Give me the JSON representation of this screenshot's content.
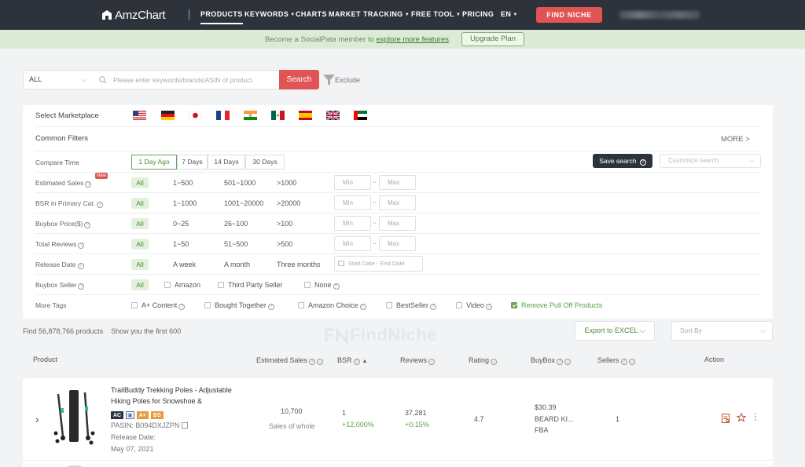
{
  "brand": {
    "name": "AmzChart"
  },
  "nav": {
    "items": [
      {
        "label": "PRODUCTS",
        "active": true
      },
      {
        "label": "KEYWORDS"
      },
      {
        "label": "CHARTS"
      },
      {
        "label": "MARKET"
      },
      {
        "label": "TRACKING"
      },
      {
        "label": "FREE TOOL"
      },
      {
        "label": "PRICING"
      },
      {
        "label": "EN"
      }
    ],
    "find_niche_label": "FIND NICHE"
  },
  "banner": {
    "prefix": "Become a SocialPata member to ",
    "link": "explore more features",
    "suffix": ".",
    "upgrade_label": "Upgrade Plan"
  },
  "search": {
    "category_value": "ALL",
    "placeholder": "Please enter keywords/brands/ASIN of product",
    "button_label": "Search",
    "exclude_label": "Exclude"
  },
  "filters": {
    "marketplace_label": "Select Marketplace",
    "marketplaces": [
      "us-flag-icon",
      "de-flag-icon",
      "jp-flag-icon",
      "fr-flag-icon",
      "in-flag-icon",
      "mx-flag-icon",
      "es-flag-icon",
      "uk-flag-icon",
      "ae-flag-icon"
    ],
    "common_filters_label": "Common Filters",
    "more_label": "MORE >",
    "compare_time": {
      "label": "Compare Time",
      "options": [
        "1 Day Ago",
        "7 Days",
        "14 Days",
        "30 Days"
      ],
      "selected": "1 Day Ago"
    },
    "save_search_label": "Save search",
    "customize_search_placeholder": "Customize search",
    "new_badge": "New",
    "all_label": "All",
    "min_placeholder": "Min",
    "max_placeholder": "Max",
    "range_sep": "~",
    "estimated_sales": {
      "label": "Estimated Sales",
      "options": [
        "1~500",
        "501~1000",
        ">1000"
      ]
    },
    "bsr": {
      "label": "BSR in Primary Cat.",
      "options": [
        "1~1000",
        "1001~20000",
        ">20000"
      ]
    },
    "buybox_price": {
      "label": "Buybox Price($)",
      "options": [
        "0~25",
        "26~100",
        ">100"
      ]
    },
    "total_reviews": {
      "label": "Total Reviews",
      "options": [
        "1~50",
        "51~500",
        ">500"
      ]
    },
    "release_date": {
      "label": "Release Date",
      "options": [
        "A week",
        "A month",
        "Three months"
      ],
      "start_placeholder": "Start Date",
      "end_placeholder": "End Date",
      "sep": "-"
    },
    "buybox_seller": {
      "label": "Buybox Seller",
      "options": [
        "Amazon",
        "Third Party Seller",
        "None"
      ]
    },
    "more_tags": {
      "label": "More Tags",
      "options": [
        "A+ Content",
        "Bought Together",
        "Amazon Choice",
        "BestSeller",
        "Video",
        "Remove Pull Off Products"
      ],
      "checked": "Remove Pull Off Products"
    }
  },
  "results": {
    "found_text": "Find 56,878,766 products",
    "first_text": "Show you the first 600",
    "watermark": "FindNiche",
    "export_label": "Export to EXCEL",
    "sort_placeholder": "Sort By"
  },
  "table": {
    "headers": {
      "product": "Product",
      "sales": "Estimated Sales",
      "bsr": "BSR",
      "reviews": "Reviews",
      "rating": "Rating",
      "buybox": "BuyBox",
      "sellers": "Sellers",
      "action": "Action"
    }
  },
  "product": {
    "title": "TrailBuddy Trekking Poles - Adjustable Hiking Poles for Snowshoe & Backpacking Gear",
    "tags": [
      "AC",
      "A+",
      "BS"
    ],
    "pasin": "PASIN: B094DXJZPN",
    "release_label": "Release Date:",
    "release_date": "May 07, 2021",
    "sales": "10,700",
    "sales_note": "Sales of whole",
    "bsr": "1",
    "bsr_change": "+12,000%",
    "reviews": "37,281",
    "reviews_change": "+0.15%",
    "rating": "4.7",
    "price": "$30.39",
    "seller": "BEARD KI...",
    "fulfillment": "FBA",
    "sellers": "1"
  },
  "colors": {
    "accent": "#e05454",
    "nav_bg": "#2e333b",
    "green": "#5aa04a"
  }
}
